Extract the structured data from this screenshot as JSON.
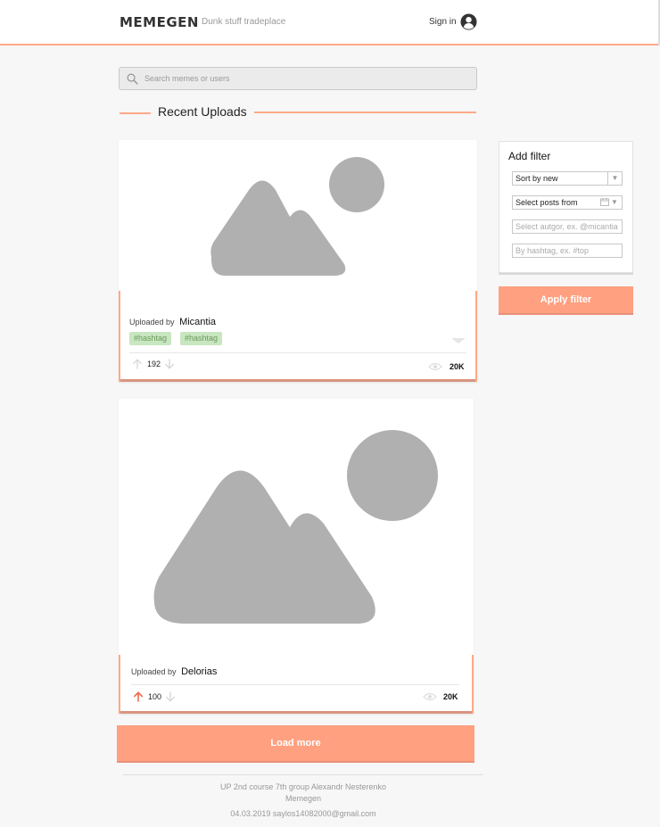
{
  "header": {
    "logo": "MEMEGEN",
    "tagline": "Dunk stuff tradeplace",
    "signin_label": "Sign in",
    "user_icon": "user-circle-icon"
  },
  "search": {
    "placeholder": "Search memes or users",
    "value": "",
    "icon": "search-icon"
  },
  "section": {
    "title": "Recent Uploads"
  },
  "posts": [
    {
      "uploaded_by_label": "Uploaded by",
      "author": "Micantia",
      "tags": [
        "#hashtag",
        "#hashtag"
      ],
      "votes": "192",
      "views": "20K",
      "upvote_active": false
    },
    {
      "uploaded_by_label": "Uploaded by",
      "author": "Delorias",
      "tags": [],
      "votes": "100",
      "views": "20K",
      "upvote_active": true
    }
  ],
  "filter": {
    "title": "Add filter",
    "sort_value": "Sort by new",
    "date_value": "Select posts from",
    "author_placeholder": "Select autgor, ex. @micantia",
    "hashtag_placeholder": "By hashtag, ex. #top",
    "apply_label": "Apply filter"
  },
  "load_more_label": "Load more",
  "footer": {
    "line1": "UP 2nd course 7th group Alexandr Nesterenko",
    "line2": "Memegen",
    "line3": "04.03.2019 saylos14082000@gmail.com"
  },
  "colors": {
    "accent": "#ffa080",
    "tag_bg": "#c8e6c0",
    "tag_text": "#6a9a5c",
    "upvote_active": "#f06a50",
    "placeholder_gray": "#b0b0b0"
  }
}
